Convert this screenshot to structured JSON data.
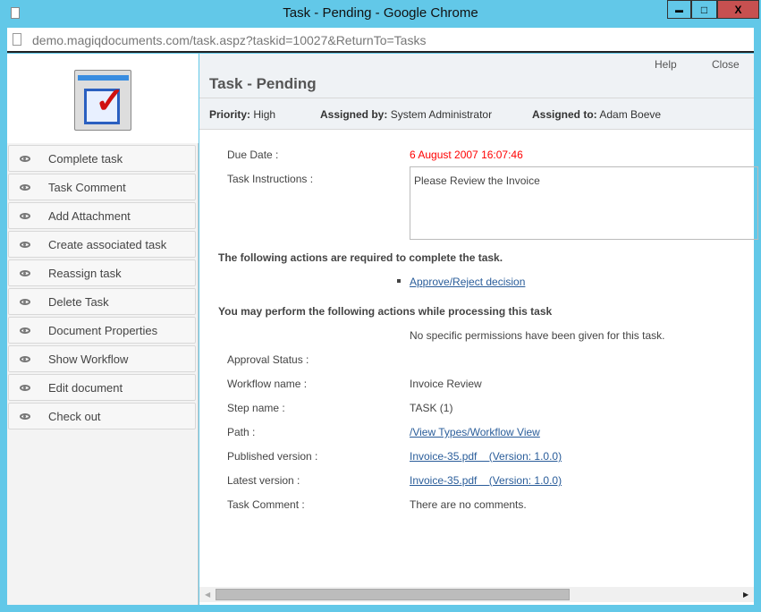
{
  "window": {
    "title": "Task - Pending - Google Chrome",
    "minimize": "▬",
    "maximize": "□",
    "close": "X",
    "url": "demo.magiqdocuments.com/task.aspz?taskid=10027&ReturnTo=Tasks"
  },
  "header": {
    "help": "Help",
    "close": "Close",
    "title": "Task - Pending"
  },
  "info": {
    "priority_label": "Priority:",
    "priority": "High",
    "assigned_by_label": "Assigned by:",
    "assigned_by": "System Administrator",
    "assigned_to_label": "Assigned to:",
    "assigned_to": "Adam Boeve"
  },
  "sidebar": {
    "items": [
      {
        "label": "Complete task"
      },
      {
        "label": "Task Comment"
      },
      {
        "label": "Add Attachment"
      },
      {
        "label": "Create associated task"
      },
      {
        "label": "Reassign task"
      },
      {
        "label": "Delete Task"
      },
      {
        "label": "Document Properties"
      },
      {
        "label": "Show Workflow"
      },
      {
        "label": "Edit document"
      },
      {
        "label": "Check out"
      }
    ]
  },
  "task": {
    "due_label": "Due Date :",
    "due": "6 August 2007 16:07:46",
    "due_color": "#ff0000",
    "instructions_label": "Task Instructions :",
    "instructions": "Please Review the Invoice",
    "required_heading": "The following actions are required to complete the task.",
    "required_action": "Approve/Reject decision",
    "optional_heading": "You may perform the following actions while processing this task",
    "optional_note": "No specific permissions have been given for this task.",
    "approval_label": "Approval Status :",
    "workflow_label": "Workflow name :",
    "workflow": "Invoice Review",
    "step_label": "Step name :",
    "step": "TASK (1)",
    "path_label": "Path :",
    "path": "/View Types/Workflow View",
    "published_label": "Published version :",
    "published": "Invoice-35.pdf    (Version: 1.0.0)",
    "latest_label": "Latest version :",
    "latest": "Invoice-35.pdf    (Version: 1.0.0)",
    "comment_label": "Task Comment :",
    "comment": "There are no comments."
  }
}
